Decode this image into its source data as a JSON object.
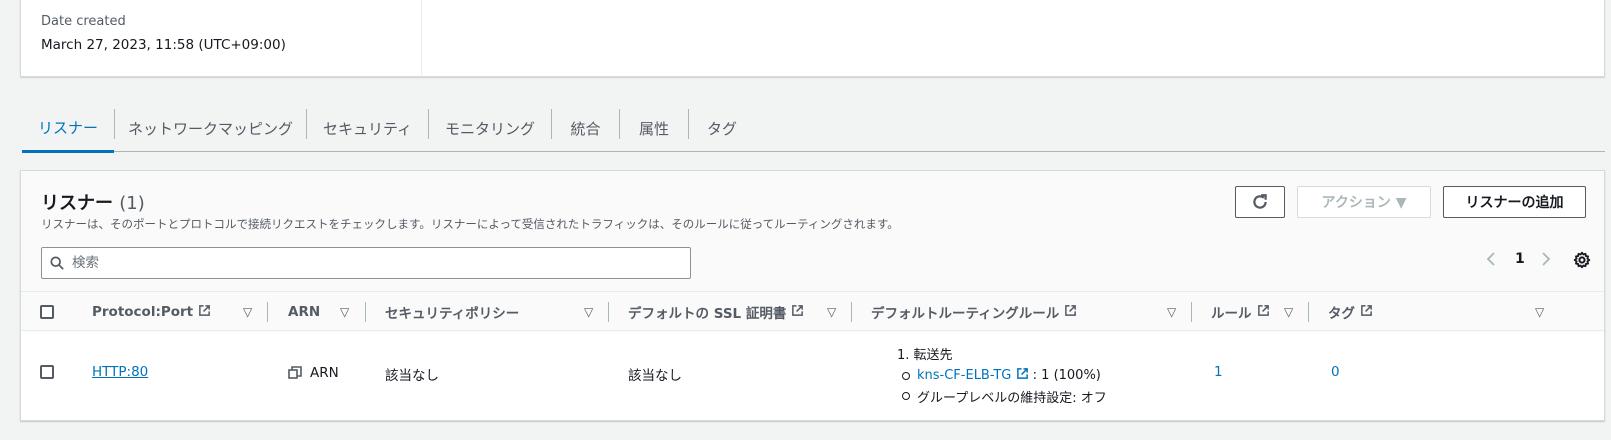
{
  "details": {
    "date_label": "Date created",
    "date_value": "March 27, 2023, 11:58 (UTC+09:00)"
  },
  "tabs": [
    {
      "label": "リスナー",
      "active": true
    },
    {
      "label": "ネットワークマッピング"
    },
    {
      "label": "セキュリティ"
    },
    {
      "label": "モニタリング"
    },
    {
      "label": "統合"
    },
    {
      "label": "属性"
    },
    {
      "label": "タグ"
    }
  ],
  "listeners": {
    "title": "リスナー",
    "count": "(1)",
    "description": "リスナーは、そのポートとプロトコルで接続リクエストをチェックします。リスナーによって受信されたトラフィックは、そのルールに従ってルーティングされます。",
    "buttons": {
      "refresh_icon": "refresh-icon",
      "action": "アクション ▼",
      "add": "リスナーの追加"
    },
    "search_placeholder": "検索",
    "page_number": "1",
    "columns": [
      "Protocol:Port",
      "ARN",
      "セキュリティポリシー",
      "デフォルトの SSL 証明書",
      "デフォルトルーティングルール",
      "ルール",
      "タグ"
    ],
    "row": {
      "protocol_port": "HTTP:80",
      "arn": "ARN",
      "security_policy": "該当なし",
      "ssl_cert": "該当なし",
      "routing_head": "1. 転送先",
      "target_group": "kns-CF-ELB-TG",
      "target_weight": ": 1 (100%)",
      "stickiness": "グループレベルの維持設定: オフ",
      "rules": "1",
      "tags": "0"
    }
  },
  "colors": {
    "accent": "#0073bb",
    "text": "#16191f",
    "muted": "#545b64"
  }
}
